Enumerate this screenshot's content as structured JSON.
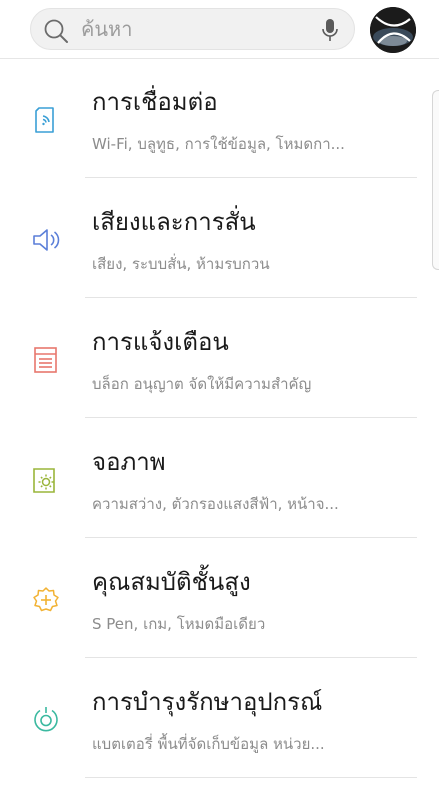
{
  "search": {
    "placeholder": "ค้นหา"
  },
  "colors": {
    "connections_icon": "#3a9fd6",
    "sound_icon": "#5b7fd8",
    "notifications_icon": "#e8776d",
    "display_icon": "#9ab53a",
    "advanced_icon": "#f2b233",
    "maintenance_icon": "#3bb9a0"
  },
  "settings": {
    "items": [
      {
        "title": "การเชื่อมต่อ",
        "subtitle": "Wi-Fi, บลูทูธ, การใช้ข้อมูล, โหมดกา...",
        "icon": "connections-icon"
      },
      {
        "title": "เสียงและการสั่น",
        "subtitle": "เสียง, ระบบสั่น, ห้ามรบกวน",
        "icon": "sound-icon"
      },
      {
        "title": "การแจ้งเตือน",
        "subtitle": "บล็อก อนุญาต จัดให้มีความสำคัญ",
        "icon": "notifications-icon"
      },
      {
        "title": "จอภาพ",
        "subtitle": "ความสว่าง, ตัวกรองแสงสีฟ้า, หน้าจ...",
        "icon": "display-icon"
      },
      {
        "title": "คุณสมบัติชั้นสูง",
        "subtitle": "S Pen, เกม, โหมดมือเดียว",
        "icon": "advanced-features-icon"
      },
      {
        "title": "การบำรุงรักษาอุปกรณ์",
        "subtitle": "แบตเตอรี่ พื้นที่จัดเก็บข้อมูล หน่วย...",
        "icon": "device-maintenance-icon"
      }
    ]
  }
}
